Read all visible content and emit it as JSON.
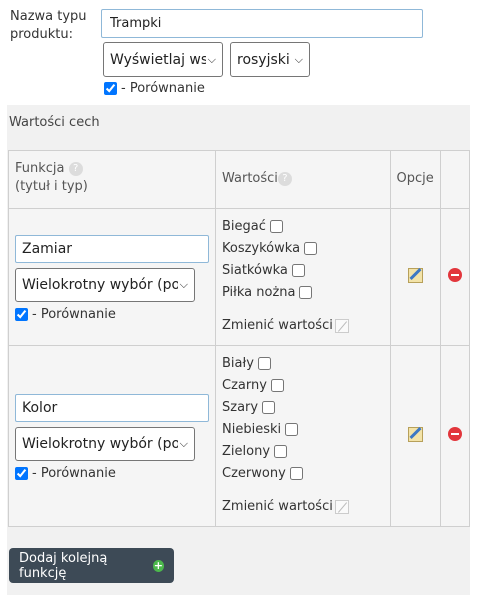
{
  "product_type": {
    "label": "Nazwa typu produktu:",
    "value": "Trampki",
    "display_select": "Wyświetlaj wsz",
    "language_select": "rosyjski (r",
    "compare_label": "- Porównanie",
    "compare_checked": true
  },
  "features_section": {
    "title": "Wartości cech",
    "headers": {
      "function": "Funkcja",
      "function_sub": "(tytuł i typ)",
      "values": "Wartości",
      "options": "Opcje"
    },
    "rows": [
      {
        "name": "Zamiar",
        "type": "Wielokrotny wybór (pole w",
        "compare_label": "- Porównanie",
        "compare_checked": true,
        "values": [
          "Biegać",
          "Koszykówka",
          "Siatkówka",
          "Piłka nożna"
        ],
        "change_label": "Zmienić wartości"
      },
      {
        "name": "Kolor",
        "type": "Wielokrotny wybór (pole w",
        "compare_label": "- Porównanie",
        "compare_checked": true,
        "values": [
          "Biały",
          "Czarny",
          "Szary",
          "Niebieski",
          "Zielony",
          "Czerwony"
        ],
        "change_label": "Zmienić wartości"
      }
    ]
  },
  "add_button": {
    "label": "Dodaj kolejną funkcję"
  },
  "colors": {
    "button_bg": "#3d4a56",
    "input_border": "#8fb8d8",
    "delete_red": "#e2363c"
  }
}
